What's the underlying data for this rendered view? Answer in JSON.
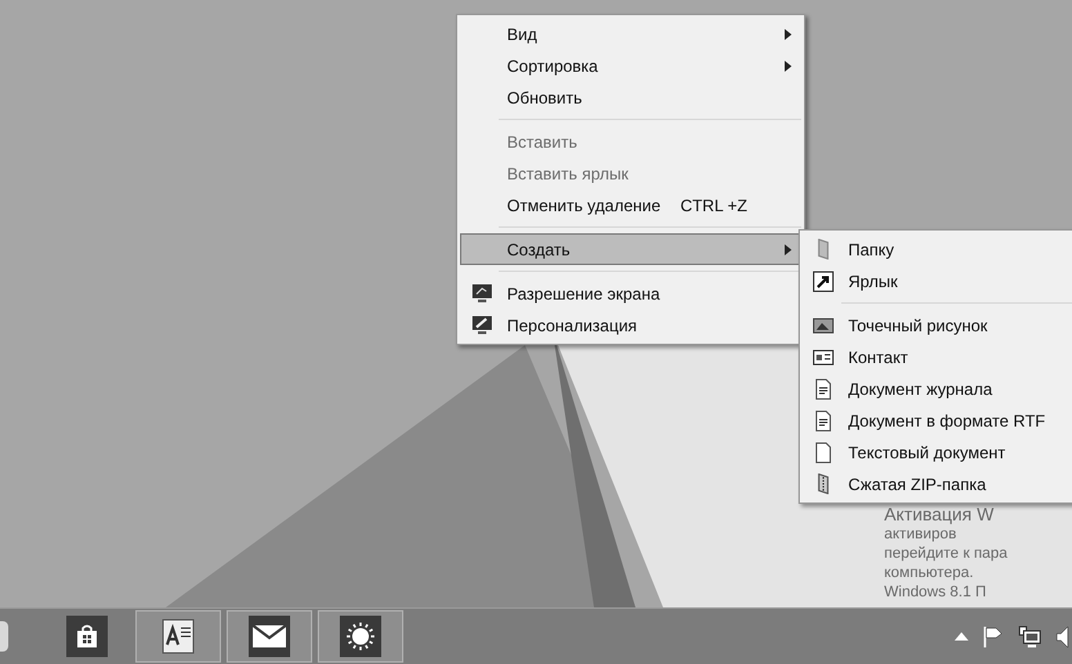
{
  "context_menu": {
    "items": [
      {
        "kind": "item",
        "label": "Вид",
        "submenu": true,
        "disabled": false,
        "selected": false
      },
      {
        "kind": "item",
        "label": "Сортировка",
        "submenu": true,
        "disabled": false,
        "selected": false
      },
      {
        "kind": "item",
        "label": "Обновить",
        "submenu": false,
        "disabled": false,
        "selected": false
      },
      {
        "kind": "separator"
      },
      {
        "kind": "item",
        "label": "Вставить",
        "submenu": false,
        "disabled": true,
        "selected": false
      },
      {
        "kind": "item",
        "label": "Вставить ярлык",
        "submenu": false,
        "disabled": true,
        "selected": false
      },
      {
        "kind": "item",
        "label": "Отменить удаление",
        "shortcut": "CTRL +Z",
        "submenu": false,
        "disabled": false,
        "selected": false
      },
      {
        "kind": "separator"
      },
      {
        "kind": "item",
        "label": "Создать",
        "submenu": true,
        "disabled": false,
        "selected": true
      },
      {
        "kind": "separator"
      },
      {
        "kind": "item",
        "label": "Разрешение экрана",
        "submenu": false,
        "disabled": false,
        "selected": false
      },
      {
        "kind": "item",
        "label": "Персонализация",
        "submenu": false,
        "disabled": false,
        "selected": false
      }
    ]
  },
  "submenu": {
    "items": [
      {
        "kind": "item",
        "label": "Папку"
      },
      {
        "kind": "item",
        "label": "Ярлык"
      },
      {
        "kind": "separator"
      },
      {
        "kind": "item",
        "label": "Точечный рисунок"
      },
      {
        "kind": "item",
        "label": "Контакт"
      },
      {
        "kind": "item",
        "label": "Документ журнала"
      },
      {
        "kind": "item",
        "label": "Документ в формате RTF"
      },
      {
        "kind": "item",
        "label": "Текстовый документ"
      },
      {
        "kind": "item",
        "label": "Сжатая ZIP-папка"
      }
    ]
  },
  "activation_notice": {
    "lines": [
      "Активация W",
      "активиров",
      "перейдите к пара",
      "компьютера."
    ],
    "edition": "Windows 8.1 П"
  },
  "taskbar": {
    "apps": [
      {
        "running": false
      },
      {
        "running": false
      },
      {
        "running": true
      },
      {
        "running": true
      },
      {
        "running": true
      }
    ]
  }
}
